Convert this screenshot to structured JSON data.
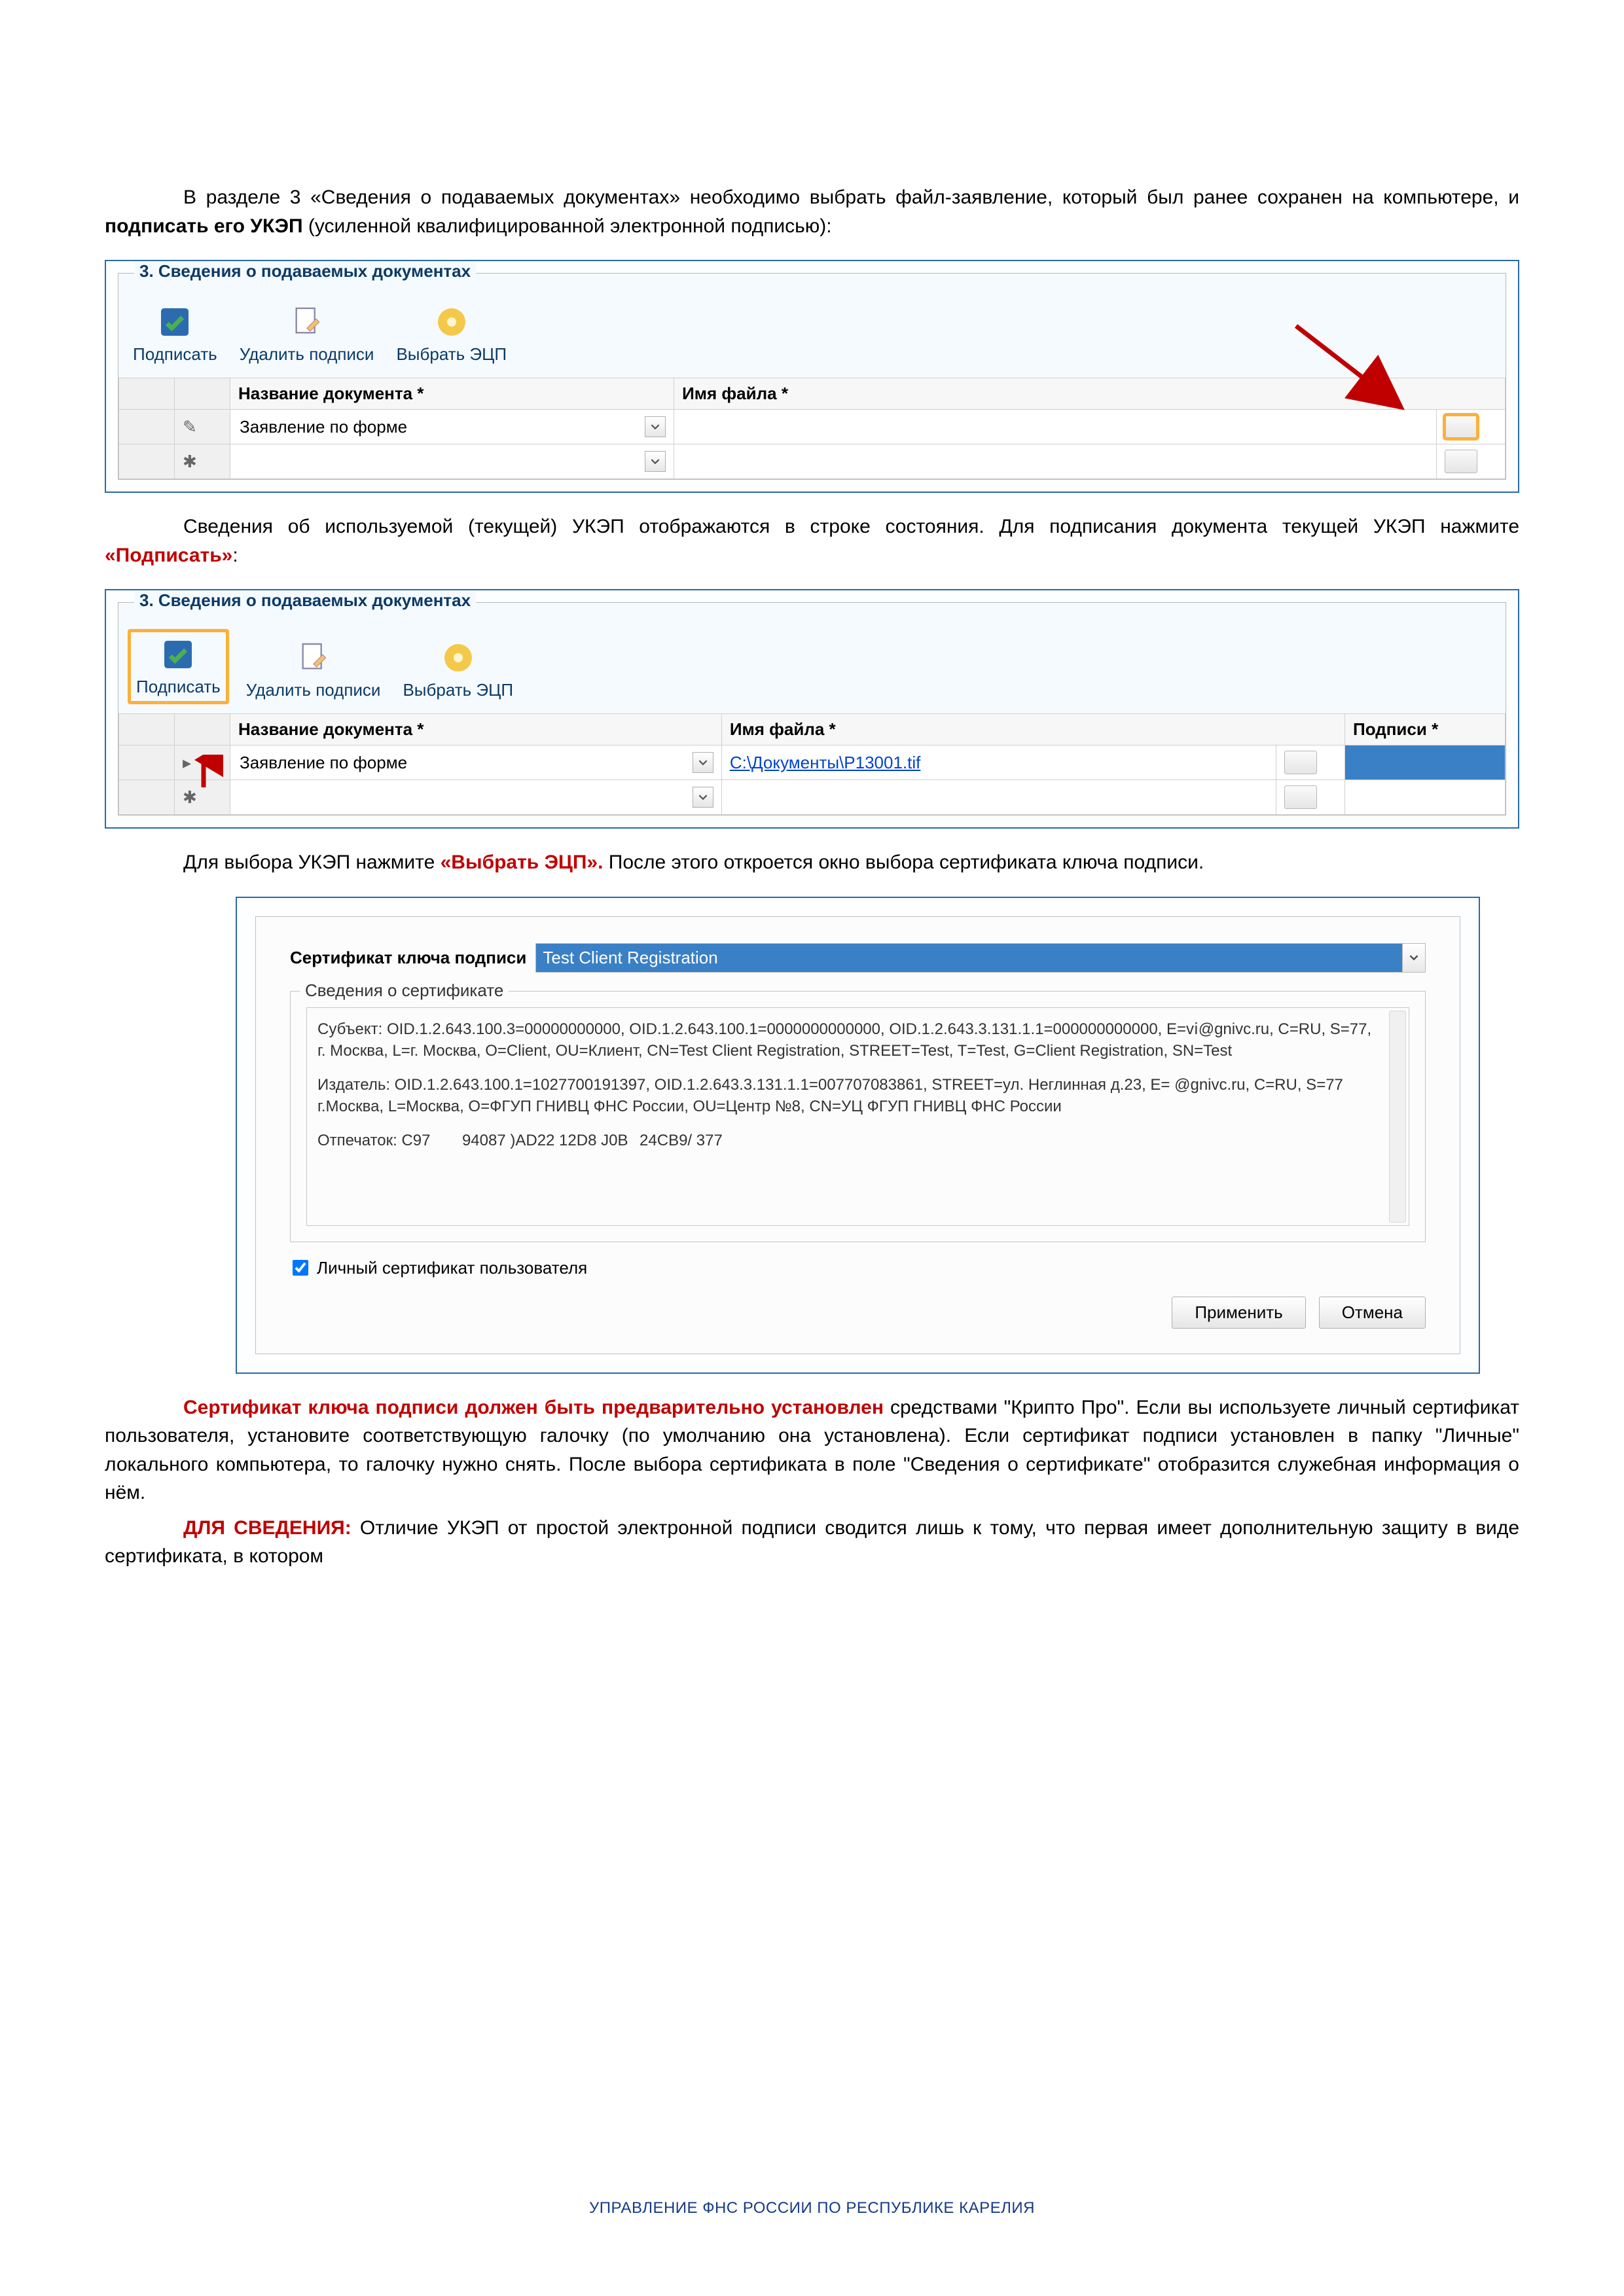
{
  "para1_part1": "В разделе 3 «Сведения о подаваемых документах» необходимо выбрать файл-заявление, который был ранее сохранен на компьютере, и ",
  "para1_highlight": "подписать его УКЭП",
  "para1_part2": " (усиленной квалифицированной электронной подписью):",
  "shot1": {
    "group_title": "3. Сведения о подаваемых документах",
    "toolbar": {
      "sign": "Подписать",
      "remove": "Удалить подписи",
      "choose": "Выбрать ЭЦП"
    },
    "headers": {
      "doc": "Название документа *",
      "file": "Имя файла *"
    },
    "row1_doc": "Заявление по форме"
  },
  "para2_text": "Сведения об используемой (текущей) УКЭП отображаются в строке состояния. Для подписания документа текущей УКЭП нажмите ",
  "para2_highlight": "«Подписать»",
  "para2_tail": ":",
  "shot2": {
    "group_title": "3. Сведения о подаваемых документах",
    "toolbar": {
      "sign": "Подписать",
      "remove": "Удалить подписи",
      "choose": "Выбрать ЭЦП"
    },
    "headers": {
      "doc": "Название документа *",
      "file": "Имя файла *",
      "sigs": "Подписи *"
    },
    "row1_doc": "Заявление по форме",
    "row1_file": "C:\\Документы\\P13001.tif"
  },
  "para3_text": "Для выбора УКЭП нажмите ",
  "para3_highlight": "«Выбрать ЭЦП».",
  "para3_tail": " После этого откроется окно выбора сертификата ключа подписи.",
  "cert": {
    "label": "Сертификат ключа подписи",
    "selected": "Test Client Registration",
    "legend": "Сведения о сертификате",
    "subject": "Субъект: OID.1.2.643.100.3=00000000000, OID.1.2.643.100.1=0000000000000, OID.1.2.643.3.131.1.1=000000000000, E=vⅰ@gnivc.ru, C=RU, S=77, г. Москва, L=г. Москва, O=Client, OU=Клиент, CN=Test Client Registration, STREET=Test, T=Test, G=Client Registration, SN=Test",
    "issuer": "Издатель: OID.1.2.643.100.1=1027700191397, OID.1.2.643.3.131.1.1=007707083861, STREET=ул. Неглинная д.23, E=   ‎@gnivc.ru, C=RU, S=77 г.Москва, L=Москва, O=ФГУП ГНИВЦ ФНС России, OU=Центр №8, CN=УЦ ФГУП ГНИВЦ ФНС России",
    "thumb": "Отпечаток: C97 ⠀⠀ 94087 )AD22 ‎12D8 J0B⠀24CB9/ 377",
    "personal": "Личный сертификат пользователя",
    "apply": "Применить",
    "cancel": "Отмена"
  },
  "para4_highlight": "Сертификат ключа подписи должен быть предварительно установлен",
  "para4_rest": " средствами \"Крипто Про\". Если вы используете личный сертификат пользователя, установите соответствующую галочку (по умолчанию она установлена). Если сертификат подписи установлен в папку \"Личные\" локального компьютера, то галочку нужно снять. После выбора сертификата в поле \"Сведения о сертификате\" отобразится служебная информация о нём.",
  "para5_label": "ДЛЯ СВЕДЕНИЯ:",
  "para5_rest": " Отличие УКЭП от простой электронной подписи сводится лишь к тому, что первая имеет дополнительную защиту в виде сертификата, в котором",
  "footer": "УПРАВЛЕНИЕ ФНС РОССИИ ПО РЕСПУБЛИКЕ КАРЕЛИЯ"
}
